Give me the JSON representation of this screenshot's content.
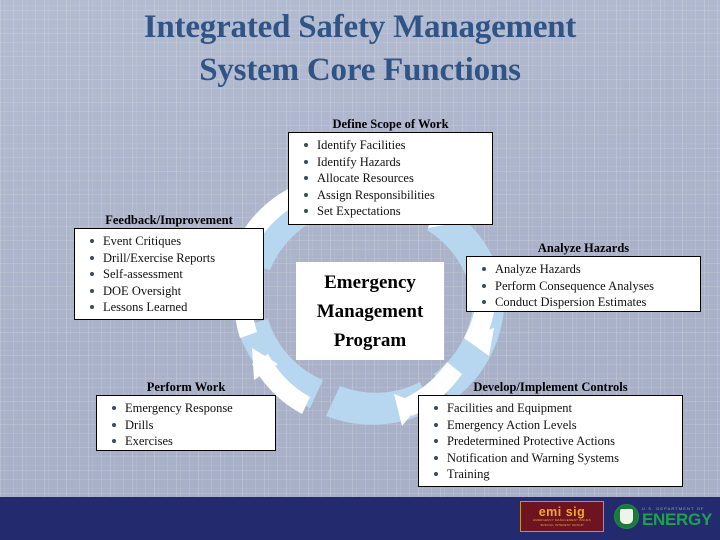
{
  "slide": {
    "title_lines": [
      "Integrated Safety Management",
      "System Core Functions"
    ],
    "background_color": "#b0b8ce",
    "title_color": "#2f5485",
    "footer_color": "#232a6e"
  },
  "center": {
    "lines": [
      "Emergency",
      "Management",
      "Program"
    ]
  },
  "panels": {
    "scope": {
      "heading": "Define Scope of Work",
      "items": [
        "Identify Facilities",
        "Identify Hazards",
        "Allocate Resources",
        "Assign Responsibilities",
        "Set Expectations"
      ]
    },
    "feedback": {
      "heading": "Feedback/Improvement",
      "items": [
        "Event Critiques",
        "Drill/Exercise Reports",
        "Self-assessment",
        "DOE Oversight",
        "Lessons Learned"
      ]
    },
    "analyze": {
      "heading": "Analyze Hazards",
      "items": [
        "Analyze Hazards",
        "Perform Consequence Analyses",
        "Conduct Dispersion Estimates"
      ]
    },
    "perform": {
      "heading": "Perform Work",
      "items": [
        "Emergency Response",
        "Drills",
        "Exercises"
      ]
    },
    "controls": {
      "heading": "Develop/Implement Controls",
      "items": [
        "Facilities and Equipment",
        "Emergency Action Levels",
        "Predetermined Protective Actions",
        "Notification and Warning Systems",
        "Training"
      ]
    }
  },
  "footer": {
    "emisig": {
      "main": "emi sig",
      "sub_line1": "EMERGENCY MANAGEMENT ISSUES",
      "sub_line2": "SPECIAL INTEREST GROUP"
    },
    "doe": {
      "department": "U.S. DEPARTMENT OF",
      "energy": "ENERGY"
    }
  }
}
